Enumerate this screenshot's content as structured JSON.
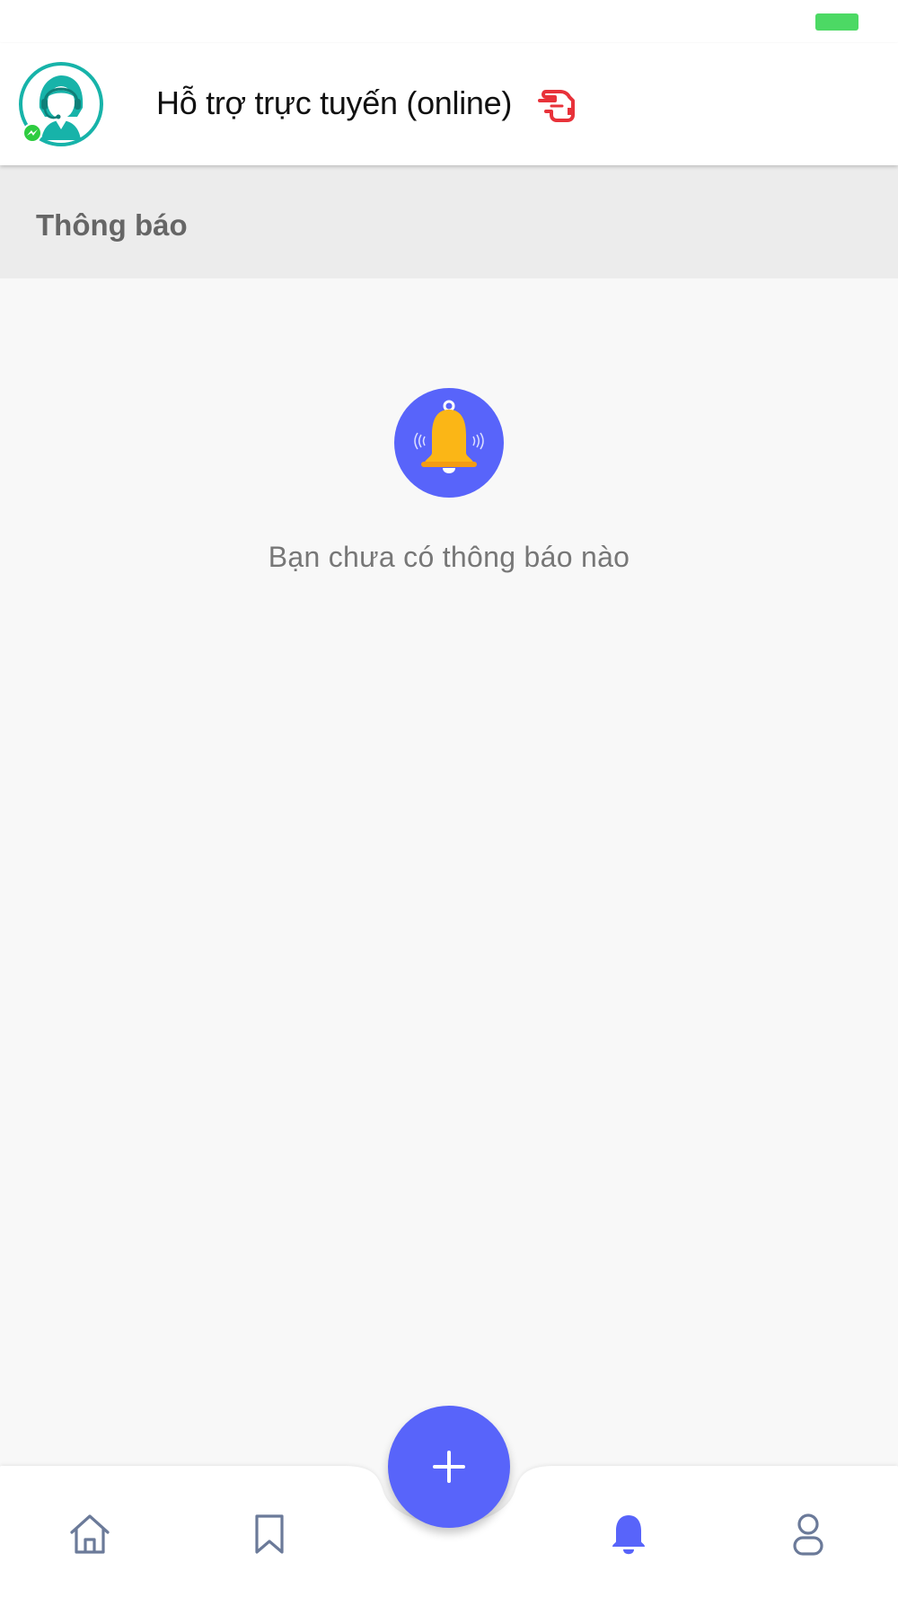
{
  "header": {
    "support_title": "Hỗ trợ trực tuyến (online)"
  },
  "section": {
    "title": "Thông báo"
  },
  "empty_state": {
    "message": "Bạn chưa có thông báo nào"
  },
  "icons": {
    "support": "support-agent-icon",
    "pointer": "pointing-hand-icon",
    "bell": "bell-icon",
    "home": "home-icon",
    "bookmark": "bookmark-icon",
    "add": "plus-icon",
    "notifications": "bell-icon",
    "profile": "user-icon"
  },
  "colors": {
    "accent": "#5864fa",
    "inactive_icon": "#6b7a99",
    "teal": "#17b3a9",
    "bell_yellow": "#fbb616",
    "pointer_red": "#e8323a",
    "battery_green": "#4cd964"
  },
  "bottom_nav": {
    "active_tab": "notifications"
  }
}
